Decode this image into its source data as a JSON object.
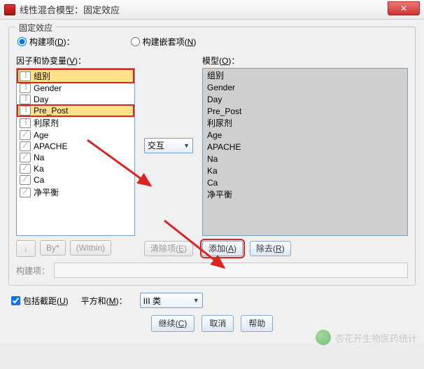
{
  "window": {
    "title": "线性混合模型：固定效应"
  },
  "group": {
    "legend": "固定效应"
  },
  "radios": {
    "build_terms": "构建项(D)：",
    "build_nested": "构建嵌套项(N)"
  },
  "labels": {
    "factors_covariates": "因子和协变量(V)：",
    "model": "模型(O)：",
    "build_term": "构建项：",
    "sum_of_squares": "平方和(M)：",
    "include_intercept": "包括截距(U)"
  },
  "factors": [
    {
      "name": "组别",
      "type": "factor",
      "sel": true,
      "red": true
    },
    {
      "name": "Gender",
      "type": "factor",
      "sel": false,
      "red": false
    },
    {
      "name": "Day",
      "type": "factor",
      "sel": false,
      "red": false
    },
    {
      "name": "Pre_Post",
      "type": "factor",
      "sel": true,
      "red": true
    },
    {
      "name": "利尿剂",
      "type": "factor",
      "sel": false,
      "red": false
    },
    {
      "name": "Age",
      "type": "cov",
      "sel": false,
      "red": false
    },
    {
      "name": "APACHE",
      "type": "cov",
      "sel": false,
      "red": false
    },
    {
      "name": "Na",
      "type": "cov",
      "sel": false,
      "red": false
    },
    {
      "name": "Ka",
      "type": "cov",
      "sel": false,
      "red": false
    },
    {
      "name": "Ca",
      "type": "cov",
      "sel": false,
      "red": false
    },
    {
      "name": "净平衡",
      "type": "cov",
      "sel": false,
      "red": false
    }
  ],
  "model_terms": [
    "组别",
    "Gender",
    "Day",
    "Pre_Post",
    "利尿剂",
    "Age",
    "APACHE",
    "Na",
    "Ka",
    "Ca",
    "净平衡"
  ],
  "combo": {
    "interaction": "交互"
  },
  "buttons": {
    "by": "By*",
    "within": "(Within)",
    "clear": "清除项(E)",
    "add": "添加(A)",
    "remove": "除去(R)",
    "continue": "继续(C)",
    "cancel": "取消",
    "help": "帮助"
  },
  "sos_value": "III 类",
  "watermark": "杏花开生物医药统计"
}
